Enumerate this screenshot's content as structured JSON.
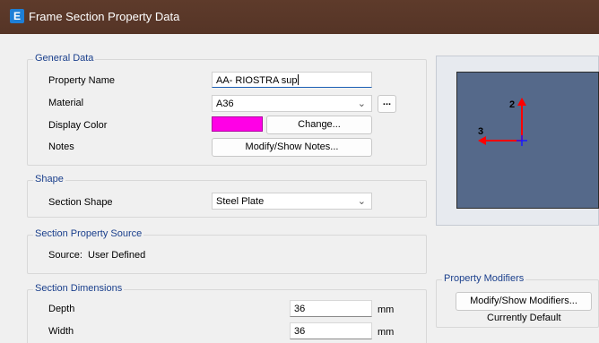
{
  "window": {
    "title": "Frame Section Property Data",
    "icon_letter": "E"
  },
  "general": {
    "title": "General Data",
    "property_name_label": "Property Name",
    "property_name_value": "AA- RIOSTRA sup",
    "material_label": "Material",
    "material_value": "A36",
    "material_more": "...",
    "display_color_label": "Display Color",
    "display_color_value": "#ff00e6",
    "change_button": "Change...",
    "notes_label": "Notes",
    "notes_button": "Modify/Show Notes..."
  },
  "shape": {
    "title": "Shape",
    "section_shape_label": "Section Shape",
    "section_shape_value": "Steel Plate"
  },
  "source": {
    "title": "Section Property Source",
    "text": "Source:  User Defined"
  },
  "dimensions": {
    "title": "Section Dimensions",
    "depth_label": "Depth",
    "depth_value": "36",
    "depth_unit": "mm",
    "width_label": "Width",
    "width_value": "36",
    "width_unit": "mm"
  },
  "preview": {
    "axis_2": "2",
    "axis_3": "3",
    "fill_color": "#55698a"
  },
  "modifiers": {
    "title": "Property Modifiers",
    "button": "Modify/Show Modifiers...",
    "status": "Currently Default"
  },
  "colors": {
    "titlebar": "#5a3a2a",
    "group_label": "#1a3f8c",
    "axis_red": "#ff0000",
    "axis_blue": "#1a1aff"
  }
}
